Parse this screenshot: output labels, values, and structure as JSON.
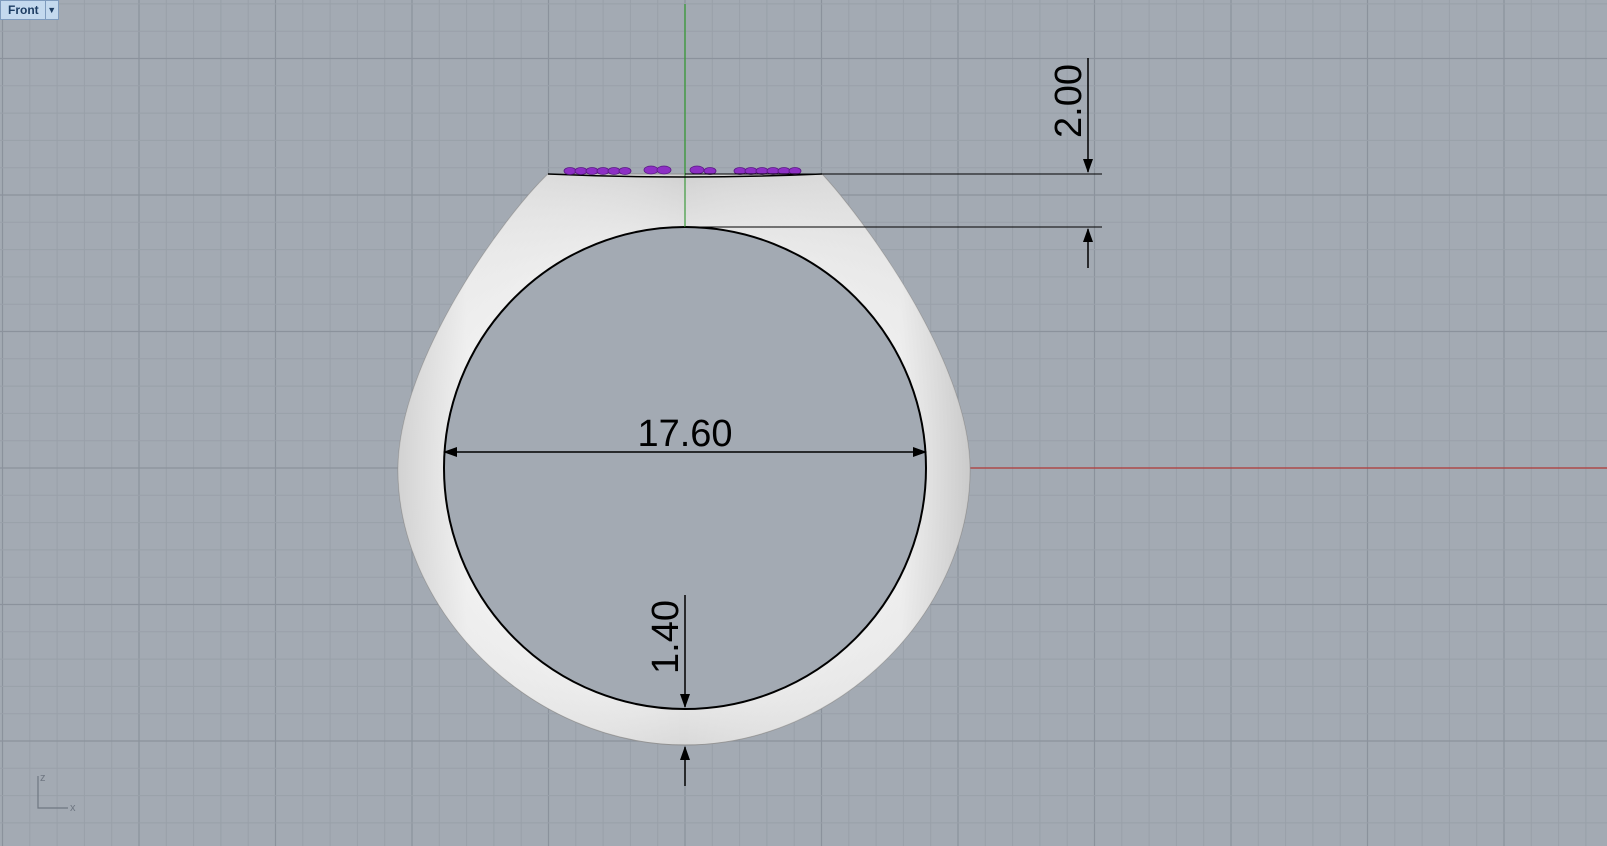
{
  "viewport": {
    "name": "Front",
    "menu_icon": "dropdown-triangle-icon",
    "axis_icon": {
      "z": "z",
      "x": "x"
    }
  },
  "dimensions": {
    "inner_diameter": "17.60",
    "top_thickness": "2.00",
    "bottom_thickness": "1.40"
  },
  "colors": {
    "background": "#a3aab3",
    "grid_minor": "#99a0a9",
    "grid_major": "#8b929c",
    "x_axis": "#b33a3a",
    "y_axis": "#3d9a3d",
    "ring_body": "#e6e6e6",
    "gems": "#8d2fc4",
    "dimension_lines": "#000000"
  }
}
